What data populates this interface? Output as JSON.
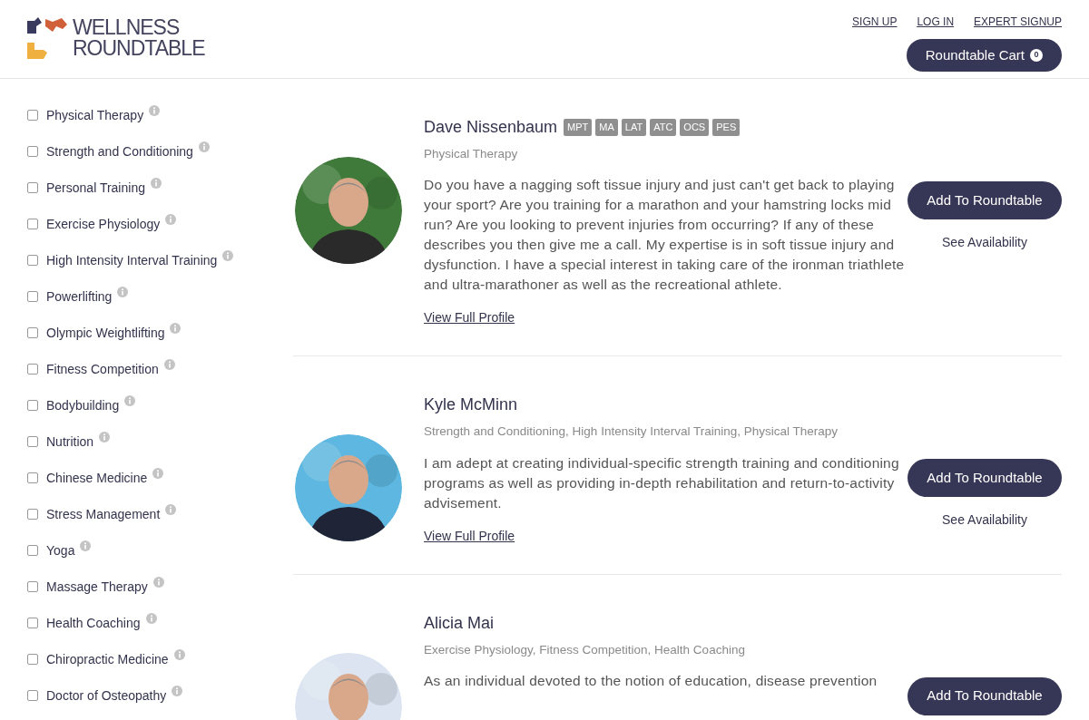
{
  "header": {
    "logo_line_1": "WELLNESS",
    "logo_line_2": "ROUNDTABLE",
    "links": [
      "SIGN UP",
      "LOG IN",
      "EXPERT SIGNUP"
    ],
    "cart": {
      "label": "Roundtable Cart",
      "count": "0"
    }
  },
  "filters": [
    {
      "label": "Physical Therapy",
      "checked": false
    },
    {
      "label": "Strength and Conditioning",
      "checked": false
    },
    {
      "label": "Personal Training",
      "checked": false
    },
    {
      "label": "Exercise Physiology",
      "checked": false
    },
    {
      "label": "High Intensity Interval Training",
      "checked": false
    },
    {
      "label": "Powerlifting",
      "checked": false
    },
    {
      "label": "Olympic Weightlifting",
      "checked": false
    },
    {
      "label": "Fitness Competition",
      "checked": false
    },
    {
      "label": "Bodybuilding",
      "checked": false
    },
    {
      "label": "Nutrition",
      "checked": false
    },
    {
      "label": "Chinese Medicine",
      "checked": false
    },
    {
      "label": "Stress Management",
      "checked": false
    },
    {
      "label": "Yoga",
      "checked": false
    },
    {
      "label": "Massage Therapy",
      "checked": false
    },
    {
      "label": "Health Coaching",
      "checked": false
    },
    {
      "label": "Chiropractic Medicine",
      "checked": false
    },
    {
      "label": "Doctor of Osteopathy",
      "checked": false
    }
  ],
  "experts": [
    {
      "name": "Dave Nissenbaum",
      "credentials": [
        "MPT",
        "MA",
        "LAT",
        "ATC",
        "OCS",
        "PES"
      ],
      "specialties": "Physical Therapy",
      "bio": "Do you have a nagging soft tissue injury and just can't get back to playing your sport? Are you training for a marathon and your hamstring locks mid run? Are you looking to prevent injuries from occurring? If any of these describes you then give me a call. My expertise is in soft tissue injury and dysfunction. I have a special interest in taking care of the ironman triathlete and ultra-marathoner as well as the recreational athlete.",
      "profile_link": "View Full Profile",
      "add_button": "Add To Roundtable",
      "availability_link": "See Availability"
    },
    {
      "name": "Kyle McMinn",
      "specialties": "Strength and Conditioning, High Intensity Interval Training, Physical Therapy",
      "bio": "I am adept at creating individual-specific strength training and conditioning programs as well as providing in-depth rehabilitation and return-to-activity advisement.",
      "profile_link": "View Full Profile",
      "add_button": "Add To Roundtable",
      "availability_link": "See Availability"
    },
    {
      "name": "Alicia Mai",
      "specialties": "Exercise Physiology, Fitness Competition, Health Coaching",
      "bio": "As an individual devoted to the notion of education, disease prevention",
      "add_button": "Add To Roundtable"
    }
  ]
}
